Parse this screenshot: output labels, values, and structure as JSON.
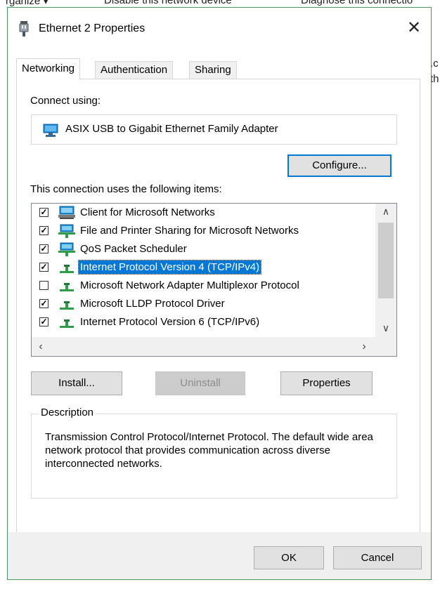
{
  "background": {
    "menubar": [
      "rganize ▾",
      "Disable this network device",
      "Diagnose this connectio"
    ],
    "side_text": [
      ".c",
      "th"
    ]
  },
  "dialog": {
    "title": "Ethernet 2 Properties",
    "close_label": "✕",
    "tabs": [
      {
        "label": "Networking",
        "active": true
      },
      {
        "label": "Authentication",
        "active": false
      },
      {
        "label": "Sharing",
        "active": false
      }
    ],
    "connect_using_label": "Connect using:",
    "adapter_name": "ASIX USB to Gigabit Ethernet Family Adapter",
    "configure_label": "Configure...",
    "items_label": "This connection uses the following items:",
    "items": [
      {
        "label": "Client for Microsoft Networks",
        "checked": true,
        "icon": "client-network-icon",
        "selected": false
      },
      {
        "label": "File and Printer Sharing for Microsoft Networks",
        "checked": true,
        "icon": "service-network-icon",
        "selected": false
      },
      {
        "label": "QoS Packet Scheduler",
        "checked": true,
        "icon": "service-network-icon",
        "selected": false
      },
      {
        "label": "Internet Protocol Version 4 (TCP/IPv4)",
        "checked": true,
        "icon": "protocol-icon",
        "selected": true
      },
      {
        "label": "Microsoft Network Adapter Multiplexor Protocol",
        "checked": false,
        "icon": "protocol-icon",
        "selected": false
      },
      {
        "label": "Microsoft LLDP Protocol Driver",
        "checked": true,
        "icon": "protocol-icon",
        "selected": false
      },
      {
        "label": "Internet Protocol Version 6 (TCP/IPv6)",
        "checked": true,
        "icon": "protocol-icon",
        "selected": false
      }
    ],
    "install_label": "Install...",
    "uninstall_label": "Uninstall",
    "properties_label": "Properties",
    "description_title": "Description",
    "description_text": "Transmission Control Protocol/Internet Protocol. The default wide area network protocol that provides communication across diverse interconnected networks.",
    "ok_label": "OK",
    "cancel_label": "Cancel"
  },
  "colors": {
    "accent": "#0078d7",
    "dialog_border": "#4a9a5e"
  }
}
